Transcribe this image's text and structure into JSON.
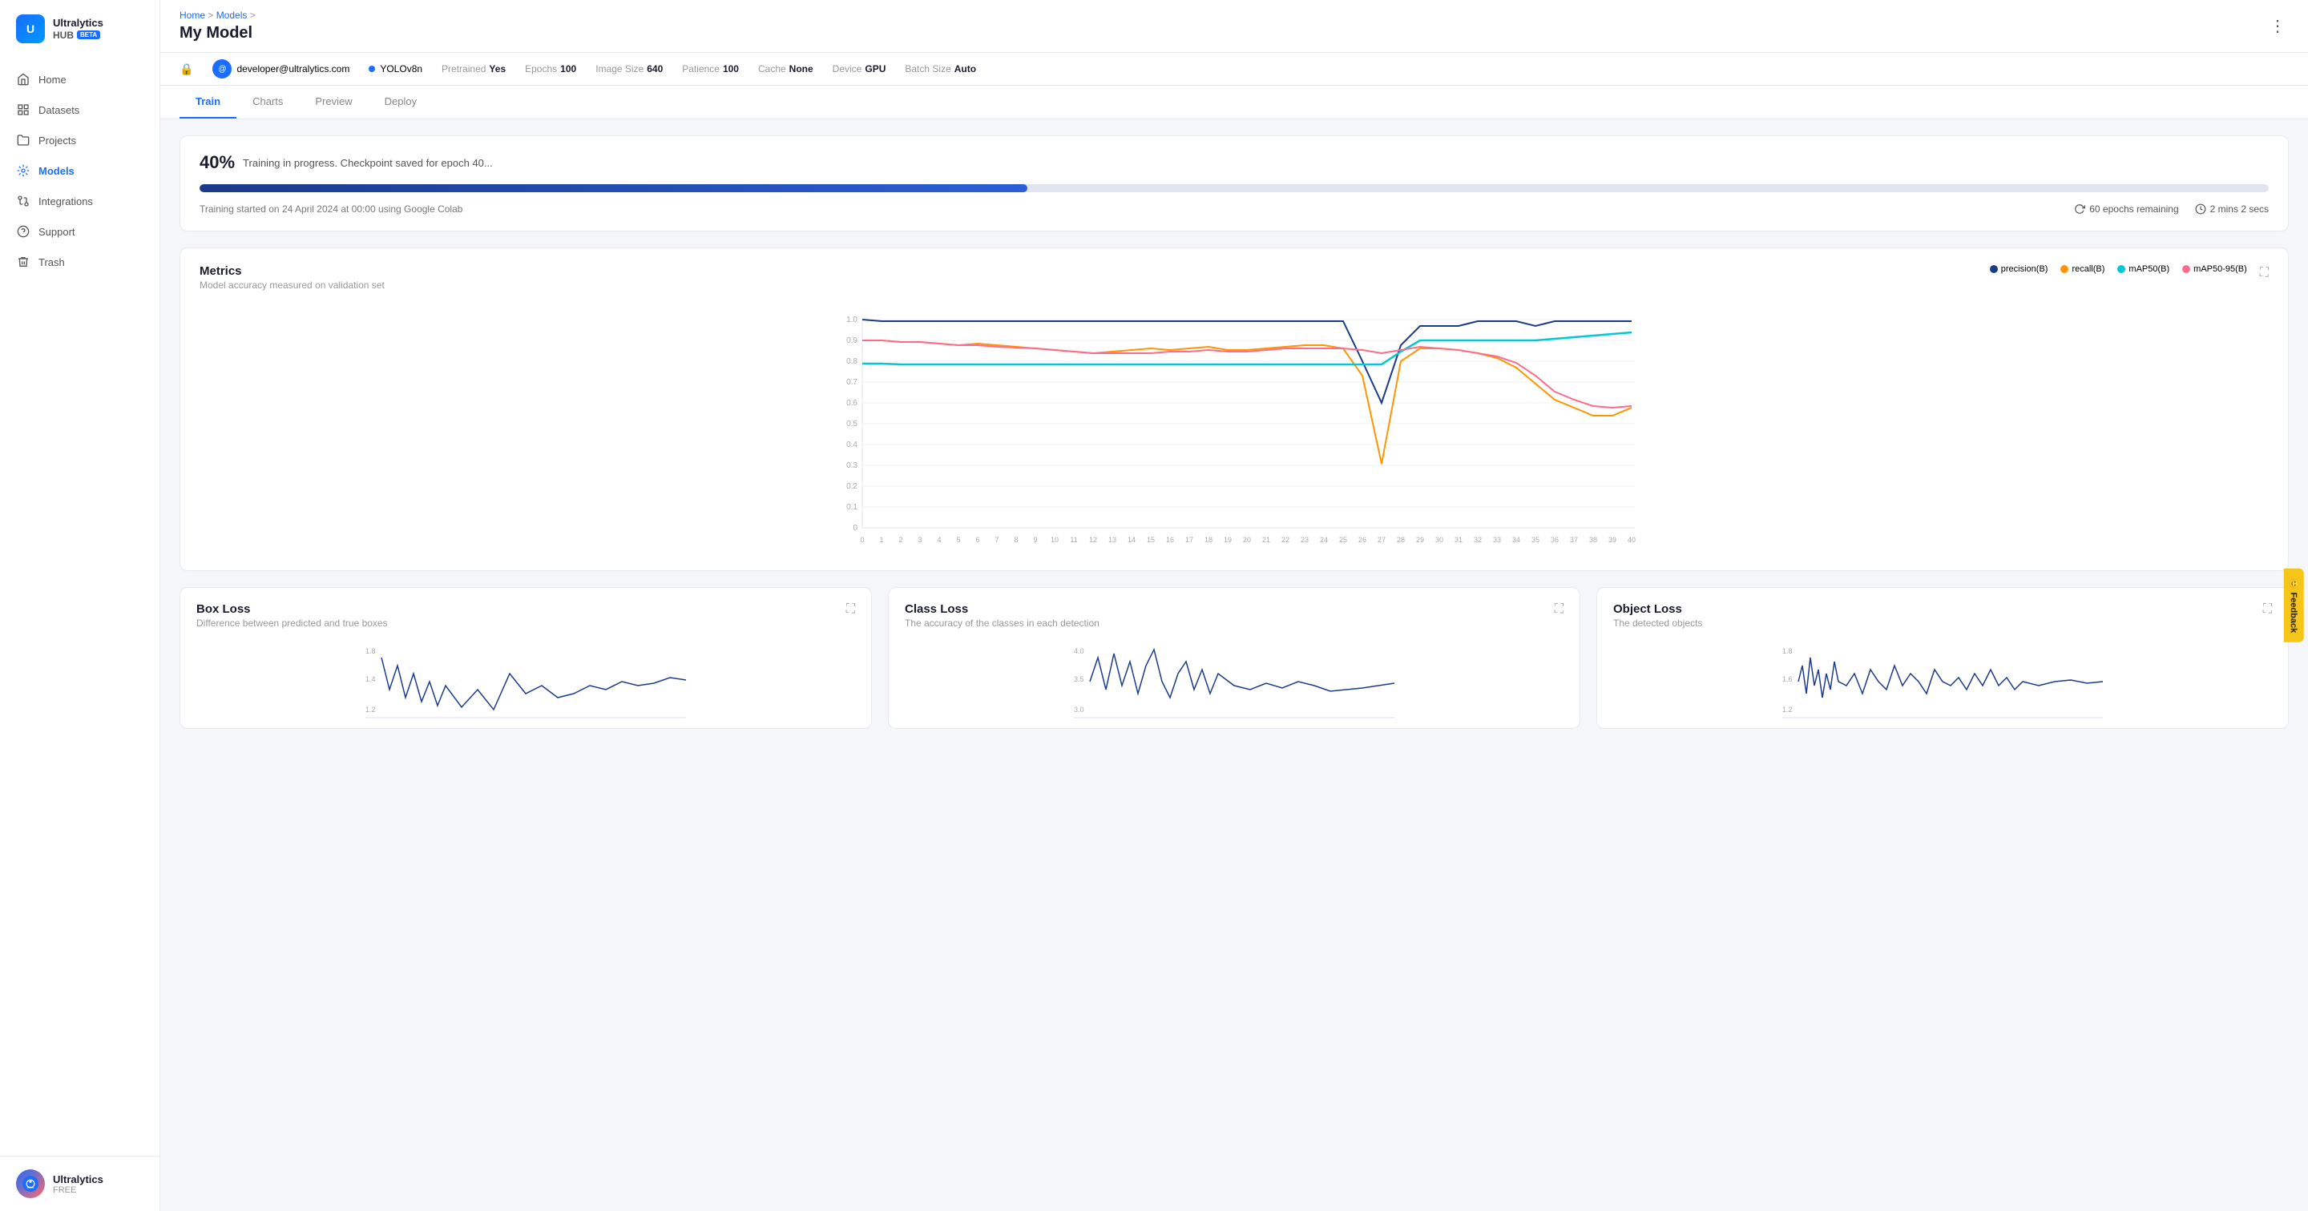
{
  "logo": {
    "name": "Ultralytics",
    "hub": "HUB",
    "beta": "BETA",
    "initials": "U"
  },
  "sidebar": {
    "items": [
      {
        "id": "home",
        "label": "Home",
        "icon": "home"
      },
      {
        "id": "datasets",
        "label": "Datasets",
        "icon": "datasets"
      },
      {
        "id": "projects",
        "label": "Projects",
        "icon": "projects"
      },
      {
        "id": "models",
        "label": "Models",
        "icon": "models",
        "active": true
      },
      {
        "id": "integrations",
        "label": "Integrations",
        "icon": "integrations"
      },
      {
        "id": "support",
        "label": "Support",
        "icon": "support"
      },
      {
        "id": "trash",
        "label": "Trash",
        "icon": "trash"
      }
    ]
  },
  "user": {
    "name": "Ultralytics",
    "plan": "FREE",
    "email": "developer@ultralytics.com"
  },
  "breadcrumb": {
    "home": "Home",
    "models": "Models",
    "current": "My Model"
  },
  "page_title": "My Model",
  "model_meta": {
    "yolo": "YOLOv8n",
    "pretrained_label": "Pretrained",
    "pretrained_value": "Yes",
    "epochs_label": "Epochs",
    "epochs_value": "100",
    "image_size_label": "Image Size",
    "image_size_value": "640",
    "patience_label": "Patience",
    "patience_value": "100",
    "cache_label": "Cache",
    "cache_value": "None",
    "device_label": "Device",
    "device_value": "GPU",
    "batch_size_label": "Batch Size",
    "batch_size_value": "Auto"
  },
  "tabs": [
    "Train",
    "Charts",
    "Preview",
    "Deploy"
  ],
  "active_tab": "Train",
  "training": {
    "percent": "40%",
    "message": "Training in progress. Checkpoint saved for epoch 40...",
    "progress": 40,
    "date": "Training started on 24 April 2024 at 00:00 using Google Colab",
    "epochs_remaining": "60 epochs remaining",
    "time_remaining": "2 mins 2 secs"
  },
  "metrics": {
    "title": "Metrics",
    "subtitle": "Model accuracy measured on validation set",
    "legend": [
      {
        "label": "precision(B)",
        "color": "#1a3a8a"
      },
      {
        "label": "recall(B)",
        "color": "#ff9500"
      },
      {
        "label": "mAP50(B)",
        "color": "#00c8d7"
      },
      {
        "label": "mAP50-95(B)",
        "color": "#ff6b8a"
      }
    ],
    "y_axis": [
      "1.0",
      "0.9",
      "0.8",
      "0.7",
      "0.6",
      "0.5",
      "0.4",
      "0.3",
      "0.2",
      "0.1",
      "0"
    ],
    "x_axis": [
      "0",
      "1",
      "2",
      "3",
      "4",
      "5",
      "6",
      "7",
      "8",
      "9",
      "10",
      "11",
      "12",
      "13",
      "14",
      "15",
      "16",
      "17",
      "18",
      "19",
      "20",
      "21",
      "22",
      "23",
      "24",
      "25",
      "26",
      "27",
      "28",
      "29",
      "30",
      "31",
      "32",
      "33",
      "34",
      "35",
      "36",
      "37",
      "38",
      "39",
      "40"
    ]
  },
  "box_loss": {
    "title": "Box Loss",
    "subtitle": "Difference between predicted and true boxes",
    "y_max": "1.8",
    "y_min": "1.2"
  },
  "class_loss": {
    "title": "Class Loss",
    "subtitle": "The accuracy of the classes in each detection",
    "y_max": "4.0",
    "y_min": "3.0"
  },
  "object_loss": {
    "title": "Object Loss",
    "subtitle": "The detected objects",
    "y_max": "1.8",
    "y_min": "1.2"
  },
  "feedback": {
    "label": "Feedback"
  }
}
